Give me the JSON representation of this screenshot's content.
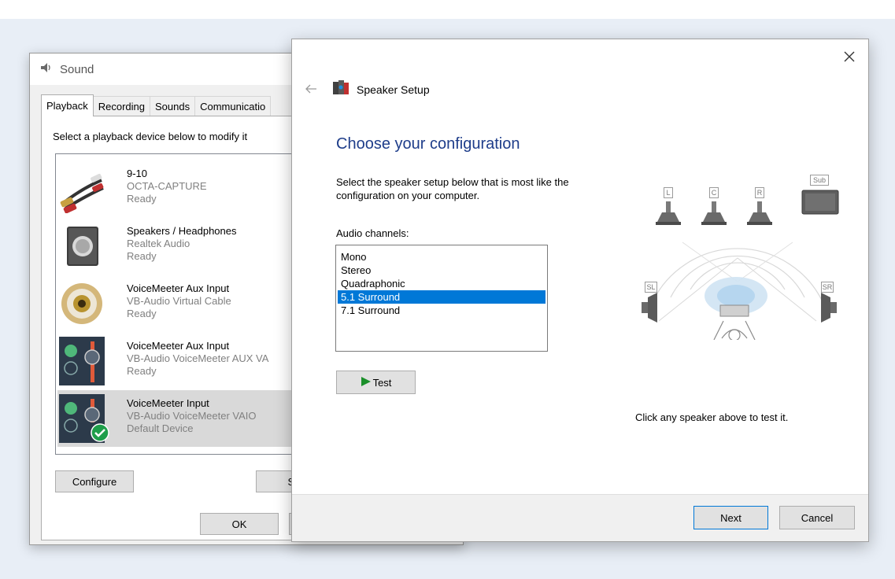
{
  "sound": {
    "title": "Sound",
    "tabs": [
      "Playback",
      "Recording",
      "Sounds",
      "Communicatio"
    ],
    "instruction": "Select a playback device below to modify it",
    "devices": [
      {
        "name": "9-10",
        "driver": "OCTA-CAPTURE",
        "status": "Ready",
        "icon": "rca-cable-icon"
      },
      {
        "name": "Speakers / Headphones",
        "driver": "Realtek Audio",
        "status": "Ready",
        "icon": "speaker-box-icon"
      },
      {
        "name": "VoiceMeeter Aux Input",
        "driver": "VB-Audio Virtual Cable",
        "status": "Ready",
        "icon": "rca-jack-icon"
      },
      {
        "name": "VoiceMeeter Aux Input",
        "driver": "VB-Audio VoiceMeeter AUX VA",
        "status": "Ready",
        "icon": "voicemeeter-icon"
      },
      {
        "name": "VoiceMeeter Input",
        "driver": "VB-Audio VoiceMeeter VAIO",
        "status": "Default Device",
        "icon": "voicemeeter-icon"
      }
    ],
    "configure_label": "Configure",
    "set_default_label": "Set D",
    "ok_label": "OK"
  },
  "wizard": {
    "title": "Speaker Setup",
    "heading": "Choose your configuration",
    "description": "Select the speaker setup below that is most like the configuration on your computer.",
    "channels_label": "Audio channels:",
    "channels": [
      "Mono",
      "Stereo",
      "Quadraphonic",
      "5.1 Surround",
      "7.1 Surround"
    ],
    "selected_channel": "5.1 Surround",
    "test_label": "Test",
    "speaker_labels": {
      "left": "L",
      "center": "C",
      "right": "R",
      "sub": "Sub",
      "surround_left": "SL",
      "surround_right": "SR"
    },
    "click_hint": "Click any speaker above to test it.",
    "next_label": "Next",
    "cancel_label": "Cancel"
  },
  "colors": {
    "accent": "#0078d7",
    "heading_blue": "#1e3d8a",
    "selected_row": "#d9d9d9",
    "default_check": "#1e9e4a"
  }
}
